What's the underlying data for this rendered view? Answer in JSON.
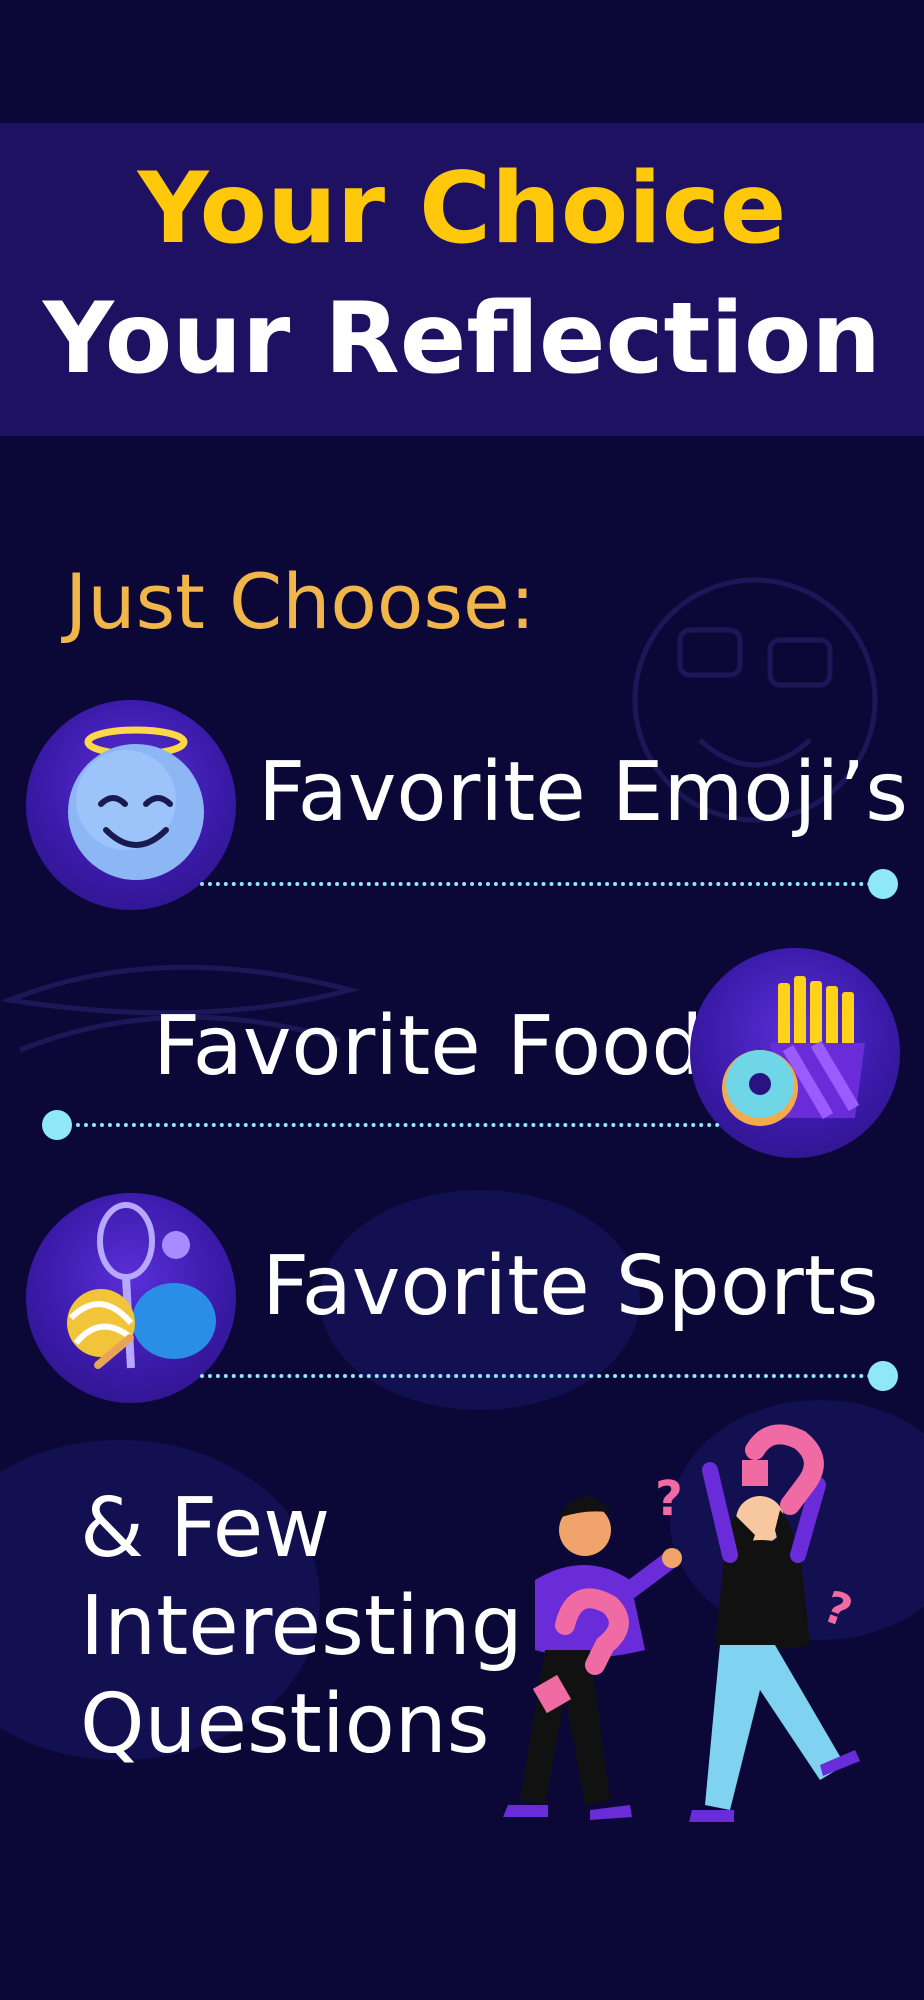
{
  "banner": {
    "line1": "Your Choice",
    "line2": "Your Reflection"
  },
  "subtitle": "Just Choose:",
  "items": [
    {
      "label": "Favorite Emoji’s",
      "icon": "angel-emoji-icon"
    },
    {
      "label": "Favorite Food",
      "icon": "fries-donut-icon"
    },
    {
      "label": "Favorite Sports",
      "icon": "sports-equipment-icon"
    }
  ],
  "closing": {
    "line1": "& Few",
    "line2": "Interesting",
    "line3": "Questions"
  },
  "colors": {
    "background": "#0b0838",
    "banner": "#1f1162",
    "accent_yellow": "#ffc80a",
    "subtitle_gold": "#f0b64a",
    "dotted_line": "#8fe8f5"
  }
}
